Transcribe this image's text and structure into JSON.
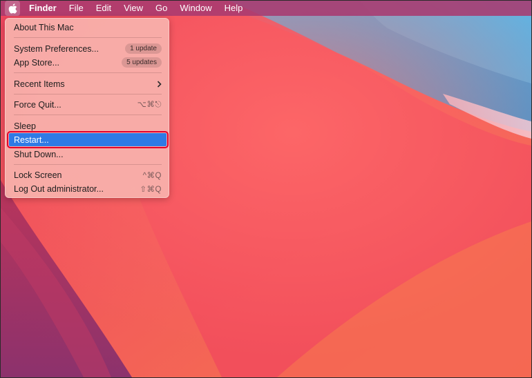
{
  "menubar": {
    "apple_icon": "apple-logo-icon",
    "items": [
      "Finder",
      "File",
      "Edit",
      "View",
      "Go",
      "Window",
      "Help"
    ]
  },
  "apple_menu": {
    "about": "About This Mac",
    "system_prefs": "System Preferences...",
    "system_prefs_badge": "1 update",
    "app_store": "App Store...",
    "app_store_badge": "5 updates",
    "recent_items": "Recent Items",
    "recent_items_icon": "chevron-right-icon",
    "force_quit": "Force Quit...",
    "force_quit_shortcut": "⌥⌘⎋",
    "sleep": "Sleep",
    "restart": "Restart...",
    "shut_down": "Shut Down...",
    "lock_screen": "Lock Screen",
    "lock_screen_shortcut": "^⌘Q",
    "log_out": "Log Out administrator...",
    "log_out_shortcut": "⇧⌘Q"
  },
  "colors": {
    "menu_highlight": "#2f7ae5",
    "highlight_outline": "#e4002b"
  }
}
